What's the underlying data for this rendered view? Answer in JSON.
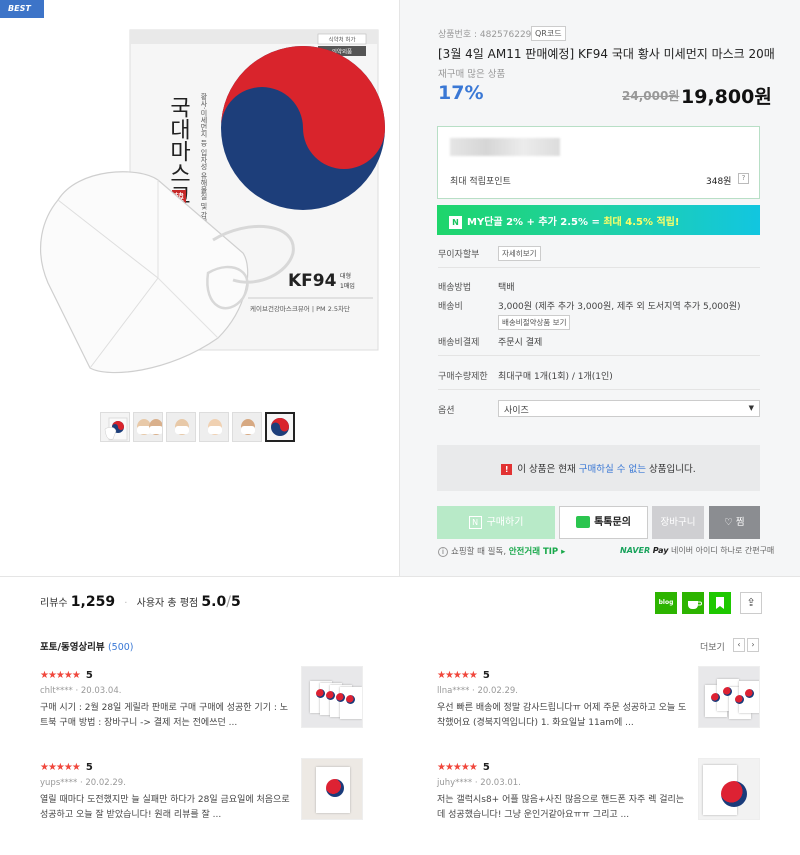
{
  "badge": "BEST",
  "product_image": {
    "package_title": "국대마스크",
    "package_subtitle": "황사·미세먼지 등 입자성 유해물질 및 감염원으로부터 호흡기 보호",
    "kf_label": "KF94",
    "size_label": "대형",
    "count_label": "1매입",
    "footer": "케이브건강마스크뷰어 | PM 2.5차단",
    "approval": "식약처 허가",
    "approval_sub": "의약외품",
    "seal": "韓"
  },
  "thumbnails_count": 6,
  "product": {
    "number_label": "상품번호 : 4825762296",
    "qr_label": "QR코드",
    "title": "[3월 4일 AM11 판매예정] KF94 국대 황사 미세먼지 마스크 20매",
    "subtitle": "재구매 많은 상품",
    "discount": "17%",
    "original_price": "24,000원",
    "sale_price": "19,800원"
  },
  "points": {
    "label": "최대 적립포인트",
    "value": "348원",
    "help": "?"
  },
  "my_band": {
    "icon": "N",
    "prefix": "MY단골 2% + 추가 2.5% = ",
    "highlight": "최대 4.5% 적립!"
  },
  "info": {
    "interest_free_label": "무이자할부",
    "interest_free_btn": "자세히보기",
    "shipping_method_label": "배송방법",
    "shipping_method_value": "택배",
    "shipping_fee_label": "배송비",
    "shipping_fee_value": "3,000원 (제주 추가 3,000원, 제주 외 도서지역 추가 5,000원)",
    "shipping_fee_btn": "배송비절약상품 보기",
    "payment_label": "배송비결제",
    "payment_value": "주문시 결제",
    "limit_label": "구매수량제한",
    "limit_value": "최대구매 1개(1회) / 1개(1인)",
    "option_label": "옵션",
    "option_selected": "사이즈"
  },
  "notice": {
    "prefix": "이 상품은 현재 ",
    "blue": "구매하실 수 없는",
    "suffix": " 상품입니다."
  },
  "buttons": {
    "buy": "구매하기",
    "talk": "톡톡문의",
    "cart": "장바구니",
    "zzim": "찜"
  },
  "tip": {
    "prefix": "쇼핑할 때 필독, ",
    "green": "안전거래 TIP ▸"
  },
  "npay": {
    "naver": "NAVER",
    "pay": "Pay",
    "text": "네이버 아이디 하나로 간편구매"
  },
  "review_summary": {
    "count_label": "리뷰수",
    "count": "1,259",
    "rating_label": "사용자 총 평점",
    "rating": "5.0",
    "rating_max": "5"
  },
  "share": {
    "blog": "blog"
  },
  "photo_reviews": {
    "label": "포토/동영상리뷰",
    "count": "(500)",
    "more": "더보기"
  },
  "reviews": [
    {
      "stars": "★★★★★",
      "score": "5",
      "user": "chlt****",
      "date": "20.03.04.",
      "body": "구매 시기 : 2월 28일 게릴라 판매로 구매 구매에 성공한 기기 : 노트북 구매 방법 : 장바구니 -> 결제 저는 전에쓰던 ..."
    },
    {
      "stars": "★★★★★",
      "score": "5",
      "user": "llna****",
      "date": "20.02.29.",
      "body": "우선 빠른 배송에 정말 감사드립니다ㅠ 어제 주문 성공하고 오늘 도착했어요 (경북지역입니다) 1. 화요일날 11am에 ..."
    },
    {
      "stars": "★★★★★",
      "score": "5",
      "user": "yups****",
      "date": "20.02.29.",
      "body": "열릴 때마다 도전했지만 늘 실패만 하다가 28일 금요일에 처음으로 성공하고 오늘 잘 받았습니다! 원래 리뷰를 잘 ..."
    },
    {
      "stars": "★★★★★",
      "score": "5",
      "user": "juhy****",
      "date": "20.03.01.",
      "body": "저는 갤럭시s8+ 어플 많음+사진 많음으로 핸드폰 자주 렉 걸리는데 성공했습니다! 그냥 운인거같아요ㅠㅠ 그리고 ..."
    }
  ],
  "colors": {
    "accent_blue": "#3a78d5",
    "naver_green": "#1ec800",
    "star_red": "#f0473c"
  }
}
